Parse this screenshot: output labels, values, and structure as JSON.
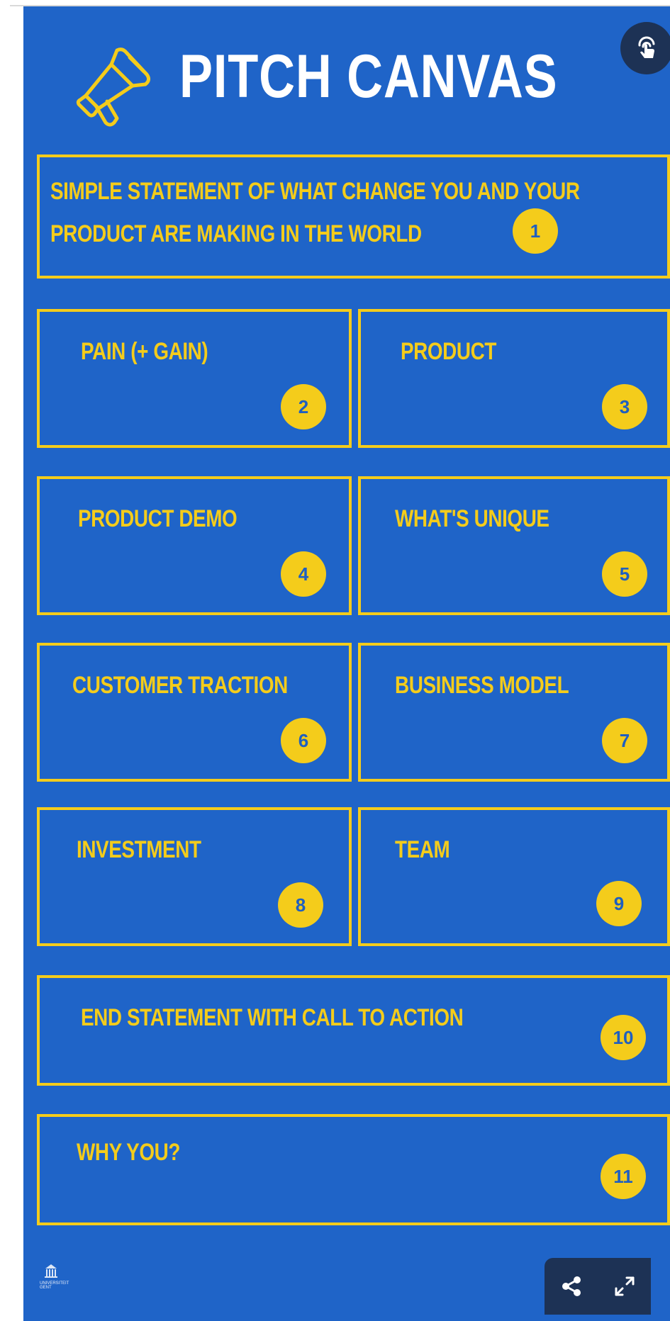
{
  "header": {
    "title": "PITCH CANVAS"
  },
  "icons": {
    "megaphone": "megaphone-icon",
    "lock": "unlock-hand-icon",
    "share": "share-icon",
    "fullscreen": "expand-icon",
    "logo": "university-logo"
  },
  "colors": {
    "background": "#1f64c8",
    "accent": "#f4cc1b",
    "title": "#ffffff",
    "dark_button": "#1d3255"
  },
  "sections": [
    {
      "label_lines": [
        "SIMPLE STATEMENT OF WHAT CHANGE YOU AND YOUR",
        "PRODUCT ARE MAKING IN THE WORLD"
      ],
      "number": "1"
    },
    {
      "label": "PAIN (+ GAIN)",
      "number": "2"
    },
    {
      "label": "PRODUCT",
      "number": "3"
    },
    {
      "label": "PRODUCT DEMO",
      "number": "4"
    },
    {
      "label": "WHAT'S UNIQUE",
      "number": "5"
    },
    {
      "label": "CUSTOMER TRACTION",
      "number": "6"
    },
    {
      "label": "BUSINESS MODEL",
      "number": "7"
    },
    {
      "label": "INVESTMENT",
      "number": "8"
    },
    {
      "label": "TEAM",
      "number": "9"
    },
    {
      "label": "END STATEMENT WITH CALL TO ACTION",
      "number": "10"
    },
    {
      "label": "WHY YOU?",
      "number": "11"
    }
  ],
  "footer": {
    "logo_text_1": "UNIVERSITEIT",
    "logo_text_2": "GENT"
  }
}
